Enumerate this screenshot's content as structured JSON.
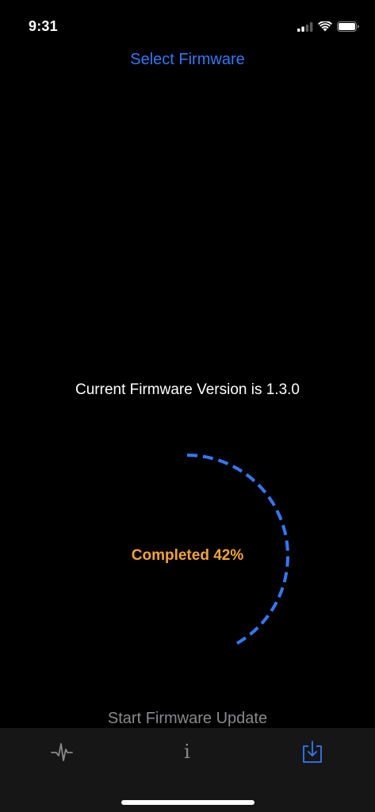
{
  "status_bar": {
    "time": "9:31"
  },
  "header": {
    "select_firmware_label": "Select Firmware"
  },
  "firmware": {
    "current_version_text": "Current Firmware Version is 1.3.0"
  },
  "progress": {
    "value": 0.42,
    "label": "Completed 42%"
  },
  "actions": {
    "start_update_label": "Start Firmware Update"
  },
  "tab_bar": {
    "tabs": [
      {
        "icon": "waveform-icon",
        "selected": false
      },
      {
        "icon": "info-icon",
        "selected": false,
        "glyph": "i"
      },
      {
        "icon": "download-icon",
        "selected": true
      }
    ]
  },
  "colors": {
    "background": "#000000",
    "accent_blue": "#3478f6",
    "progress_orange": "#f2a33a",
    "disabled_gray": "#8a8a8e",
    "tab_bar_background": "#161616"
  }
}
